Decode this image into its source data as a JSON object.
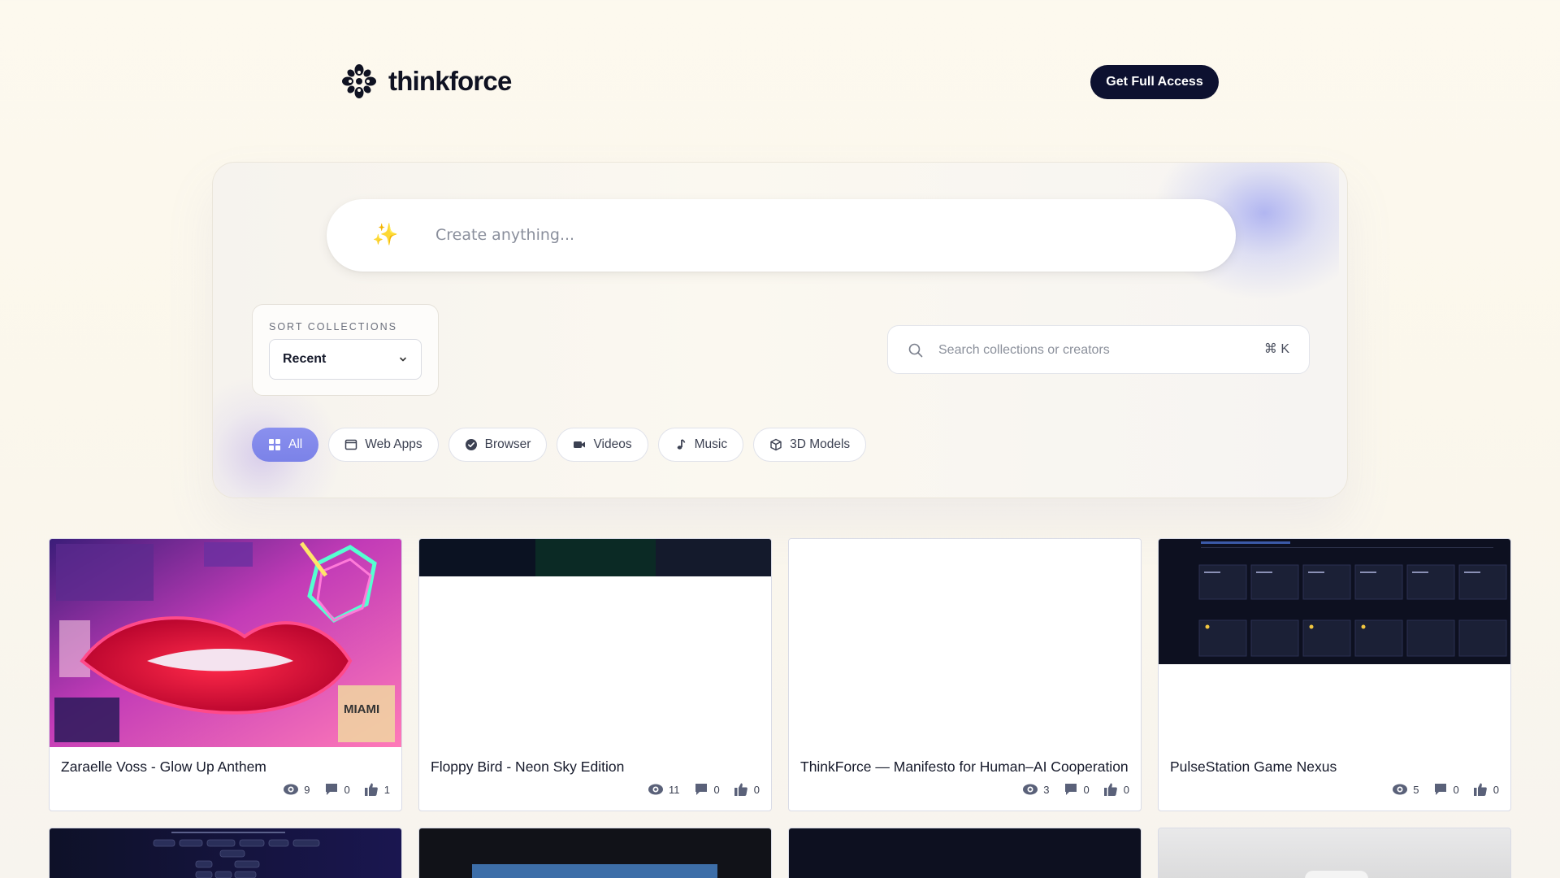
{
  "header": {
    "brand": "thinkforce",
    "cta_label": "Get Full Access"
  },
  "hero": {
    "prompt_placeholder": "Create anything...",
    "sparkle_icon": "sparkles-icon",
    "sort": {
      "label": "SORT COLLECTIONS",
      "selected": "Recent"
    },
    "search": {
      "placeholder": "Search collections or creators",
      "shortcut": "⌘ K"
    },
    "filters": [
      {
        "label": "All",
        "icon": "grid-icon",
        "active": true
      },
      {
        "label": "Web Apps",
        "icon": "window-icon",
        "active": false
      },
      {
        "label": "Browser",
        "icon": "check-circle-icon",
        "active": false
      },
      {
        "label": "Videos",
        "icon": "video-camera-icon",
        "active": false
      },
      {
        "label": "Music",
        "icon": "music-note-icon",
        "active": false
      },
      {
        "label": "3D Models",
        "icon": "cube-icon",
        "active": false
      }
    ]
  },
  "cards": [
    {
      "title": "Zaraelle Voss - Glow Up Anthem",
      "views": "9",
      "comments": "0",
      "likes": "1"
    },
    {
      "title": "Floppy Bird - Neon Sky Edition",
      "views": "11",
      "comments": "0",
      "likes": "0"
    },
    {
      "title": "ThinkForce — Manifesto for Human–AI Cooperation",
      "views": "3",
      "comments": "0",
      "likes": "0"
    },
    {
      "title": "PulseStation Game Nexus",
      "views": "5",
      "comments": "0",
      "likes": "0"
    }
  ],
  "colors": {
    "accent": "#7b82e8",
    "cta_bg": "#0d1130",
    "stat_icon": "#5a6179"
  }
}
